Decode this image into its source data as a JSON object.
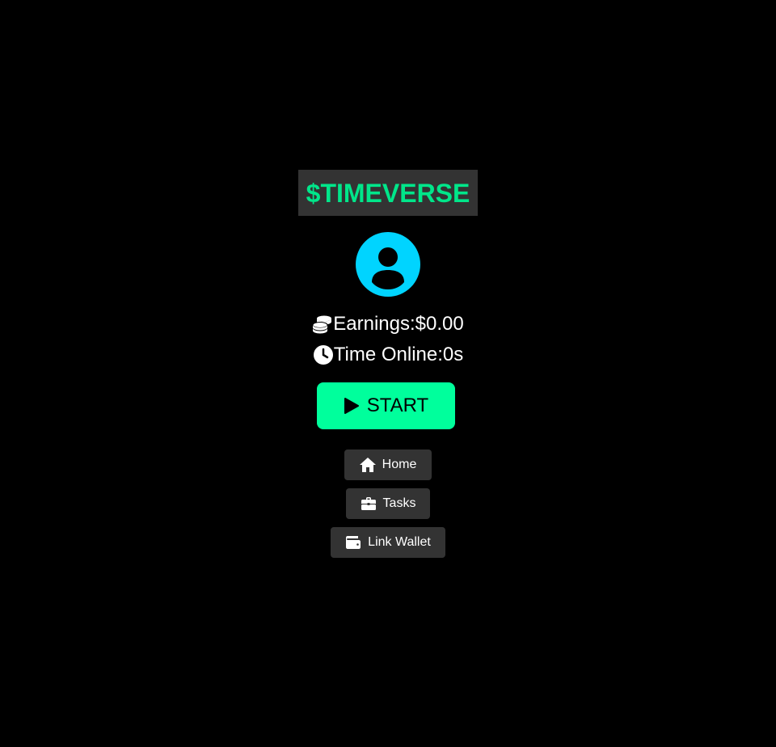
{
  "app": {
    "brand_title": "$TIMEVERSE"
  },
  "profile": {
    "avatar_icon": "user-circle-icon",
    "avatar_color": "#00d4ff"
  },
  "stats": {
    "earnings_label": "Earnings:",
    "earnings_value": "$0.00",
    "earnings_icon": "coins-icon",
    "time_label": "Time Online:",
    "time_value": "0s",
    "time_icon": "clock-icon"
  },
  "start_button": {
    "label": "START",
    "icon": "play-icon",
    "color": "#00ff9c"
  },
  "nav": [
    {
      "label": "Home",
      "icon": "home-icon"
    },
    {
      "label": "Tasks",
      "icon": "briefcase-icon"
    },
    {
      "label": "Link Wallet",
      "icon": "wallet-icon"
    }
  ],
  "colors": {
    "background": "#000000",
    "panel": "#333333",
    "brand_accent": "#00e68a"
  }
}
